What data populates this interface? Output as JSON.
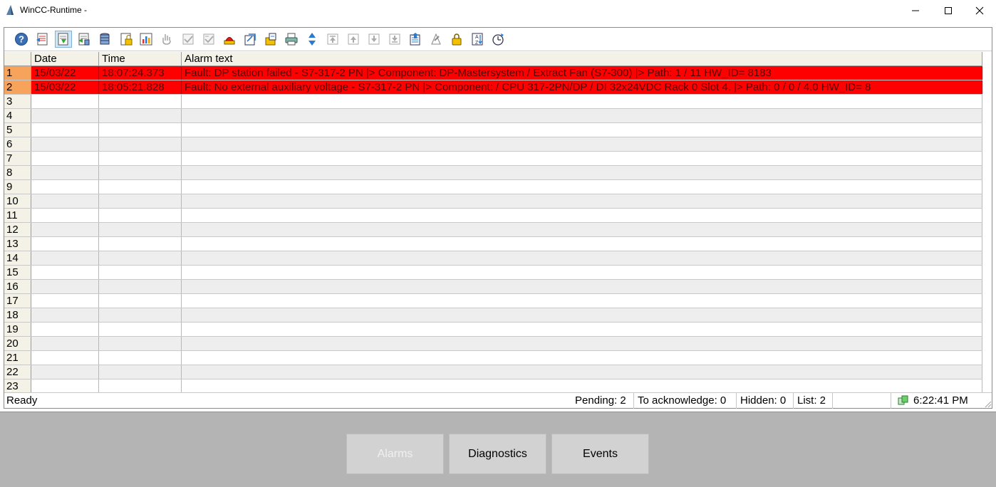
{
  "window": {
    "title": "WinCC-Runtime -"
  },
  "colors": {
    "alarm_row": "#ff0000",
    "alarm_row_number": "#f7a35c",
    "header_bg": "#f4f1e6",
    "bottom_panel": "#b4b4b4"
  },
  "toolbar": {
    "buttons": [
      {
        "icon": "help-icon"
      },
      {
        "icon": "current-alarms-icon"
      },
      {
        "icon": "history-icon",
        "pressed": true
      },
      {
        "icon": "short-term-archive-icon"
      },
      {
        "icon": "archive-list-icon"
      },
      {
        "icon": "locked-list-icon"
      },
      {
        "icon": "hit-list-icon"
      },
      {
        "icon": "single-acknowledge-icon"
      },
      {
        "icon": "group-acknowledge-icon"
      },
      {
        "icon": "emergency-acknowledge-icon"
      },
      {
        "icon": "horn-icon"
      },
      {
        "icon": "selection-dialog-icon"
      },
      {
        "icon": "display-options-icon"
      },
      {
        "icon": "print-icon"
      },
      {
        "icon": "autoscroll-icon"
      },
      {
        "icon": "first-message-icon"
      },
      {
        "icon": "previous-message-icon"
      },
      {
        "icon": "next-message-icon"
      },
      {
        "icon": "last-message-icon"
      },
      {
        "icon": "info-text-icon"
      },
      {
        "icon": "comment-icon"
      },
      {
        "icon": "lock-icon"
      },
      {
        "icon": "sort-icon"
      },
      {
        "icon": "time-base-icon"
      }
    ]
  },
  "grid": {
    "columns": [
      "Date",
      "Time",
      "Alarm text"
    ],
    "rows": [
      {
        "num": "1",
        "date": "15/03/22",
        "time": "18:07:24.373",
        "text": "Fault: DP station failed -  S7-317-2 PN   |> Component: DP-Mastersystem / Extract Fan (S7-300)   |> Path: 1 / 11  HW_ID= 8183",
        "alarm": true
      },
      {
        "num": "2",
        "date": "15/03/22",
        "time": "18:05:21.828",
        "text": "Fault: No external auxiliary voltage -  S7-317-2 PN   |> Component:  / CPU 317-2PN/DP / DI 32x24VDC Rack 0 Slot 4.   |> Path: 0 / 0 / 4.0  HW_ID= 8",
        "alarm": true
      },
      {
        "num": "3"
      },
      {
        "num": "4"
      },
      {
        "num": "5"
      },
      {
        "num": "6"
      },
      {
        "num": "7"
      },
      {
        "num": "8"
      },
      {
        "num": "9"
      },
      {
        "num": "10"
      },
      {
        "num": "11"
      },
      {
        "num": "12"
      },
      {
        "num": "13"
      },
      {
        "num": "14"
      },
      {
        "num": "15"
      },
      {
        "num": "16"
      },
      {
        "num": "17"
      },
      {
        "num": "18"
      },
      {
        "num": "19"
      },
      {
        "num": "20"
      },
      {
        "num": "21"
      },
      {
        "num": "22"
      },
      {
        "num": "23"
      }
    ]
  },
  "statusbar": {
    "ready": "Ready",
    "pending": "Pending: 2",
    "to_acknowledge": "To acknowledge: 0",
    "hidden": "Hidden: 0",
    "list": "List: 2",
    "time": "6:22:41 PM"
  },
  "navigation": {
    "alarms": "Alarms",
    "diagnostics": "Diagnostics",
    "events": "Events"
  }
}
